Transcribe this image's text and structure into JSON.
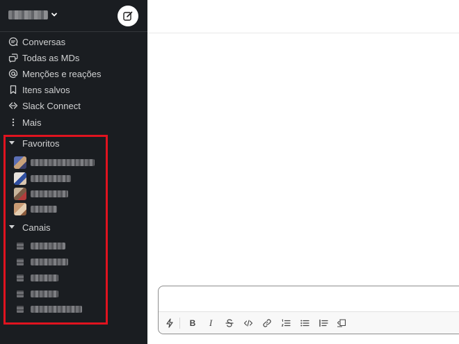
{
  "sidebar": {
    "nav": [
      {
        "label": "Conversas",
        "icon": "threads-icon"
      },
      {
        "label": "Todas as MDs",
        "icon": "direct-messages-icon"
      },
      {
        "label": "Menções e reações",
        "icon": "at-sign-icon"
      },
      {
        "label": "Itens salvos",
        "icon": "bookmark-icon"
      },
      {
        "label": "Slack Connect",
        "icon": "slack-connect-icon"
      },
      {
        "label": "Mais",
        "icon": "more-vertical-icon"
      }
    ],
    "favorites_label": "Favoritos",
    "channels_label": "Canais"
  },
  "composer": {
    "toolbar": {
      "bold": "B",
      "italic": "I"
    }
  },
  "colors": {
    "sidebar_bg": "#1a1d21",
    "sidebar_text": "#d1d2d3",
    "highlight": "#e0131f"
  }
}
